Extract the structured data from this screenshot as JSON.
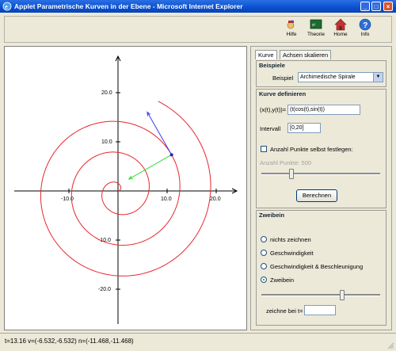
{
  "window": {
    "title": "Applet Parametrische Kurven in der Ebene - Microsoft Internet Explorer",
    "minimize_symbol": "_",
    "maximize_symbol": "□",
    "close_symbol": "×"
  },
  "toolbar": {
    "items": [
      {
        "label": "Hilfe",
        "icon": "help-icon"
      },
      {
        "label": "Theorie",
        "icon": "theory-icon"
      },
      {
        "label": "Home",
        "icon": "home-icon"
      },
      {
        "label": "Info",
        "icon": "info-icon"
      }
    ]
  },
  "plot": {
    "x_ticks": [
      "-10.0",
      "10.0",
      "20.0"
    ],
    "y_ticks": [
      "20.0",
      "10.0",
      "-10.0",
      "-20.0"
    ],
    "curve_color": "#e8262e",
    "velocity_color": "#3a3af0",
    "normal_color": "#3ad83a",
    "point_color": "#2020c0",
    "t_range": [
      0,
      20
    ],
    "t_value": 13.16,
    "velocity": [
      -6.532,
      -6.532
    ],
    "normal": [
      -11.468,
      -11.468
    ]
  },
  "tabs": [
    "Kurve",
    "Achsen skalieren"
  ],
  "beispiele": {
    "title": "Beispiele",
    "label": "Beispiel",
    "selected": "Archimedische Spirale"
  },
  "kurve": {
    "title": "Kurve definieren",
    "expr_label": "(x(t),y(t))=",
    "expr_value": "(t(cos(t),sin(t))",
    "interval_label": "Intervall",
    "interval_value": "[0,20]",
    "points_checkbox": "Anzahl Punkte selbst festlegen:",
    "points_label": "Anzahl Punkte: 500",
    "compute_button": "Berechnen"
  },
  "zweibein": {
    "title": "Zweibein",
    "options": [
      "nichts zeichnen",
      "Geschwindigkeit",
      "Geschwindigkeit & Beschleunigung",
      "Zweibein"
    ],
    "selected_index": 3,
    "draw_at_label": "zeichne bei t=",
    "draw_at_value": ""
  },
  "status": {
    "text": "t=13.16 v=(-6.532,-6.532)  n=(-11.468,-11.468)"
  }
}
